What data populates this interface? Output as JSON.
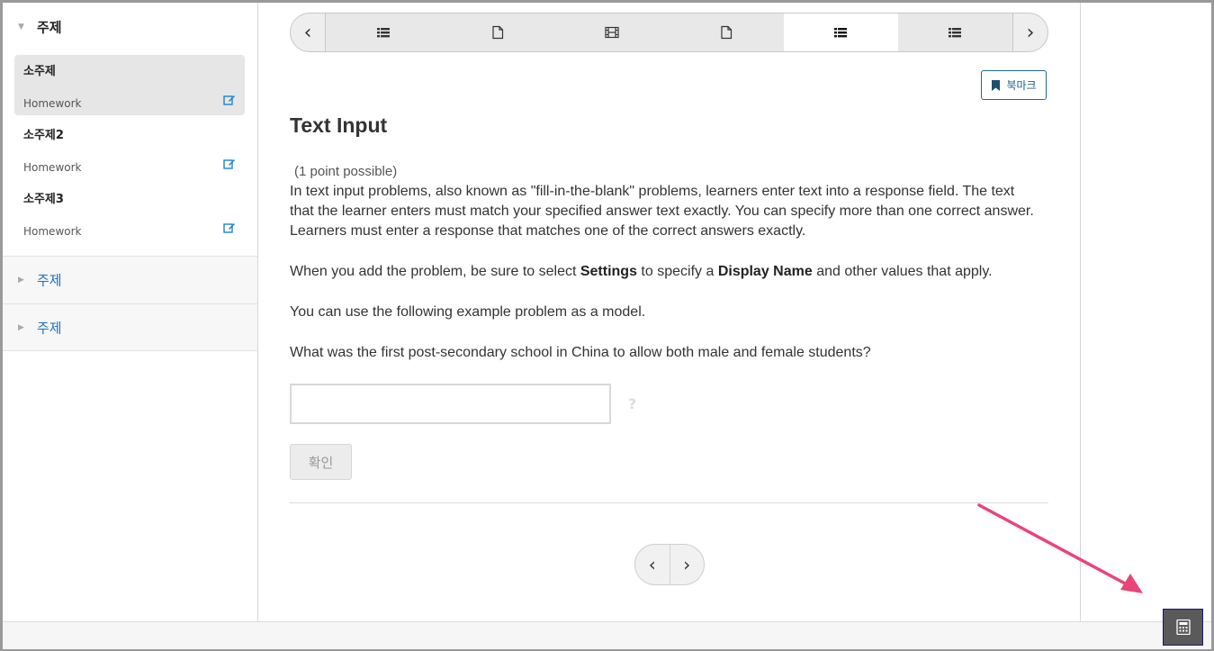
{
  "sidebar": {
    "sections": [
      {
        "title": "주제",
        "expanded": true
      },
      {
        "title": "주제",
        "expanded": false
      },
      {
        "title": "주제",
        "expanded": false
      }
    ],
    "subsections": [
      {
        "title": "소주제",
        "meta": "Homework",
        "active": true
      },
      {
        "title": "소주제2",
        "meta": "Homework",
        "active": false
      },
      {
        "title": "소주제3",
        "meta": "Homework",
        "active": false
      }
    ]
  },
  "sequence_nav": {
    "tabs": [
      {
        "icon": "list-icon"
      },
      {
        "icon": "document-icon"
      },
      {
        "icon": "film-icon"
      },
      {
        "icon": "document-icon"
      },
      {
        "icon": "list-icon",
        "active": true
      },
      {
        "icon": "list-icon"
      }
    ]
  },
  "bookmark": {
    "label": "북마크"
  },
  "problem": {
    "title": "Text Input",
    "points": "(1 point possible)",
    "intro": "In text input problems, also known as \"fill-in-the-blank\" problems, learners enter text into a response field. The text that the learner enters must match your specified answer text exactly. You can specify more than one correct answer. Learners must enter a response that matches one of the correct answers exactly.",
    "settings_before": "When you add the problem, be sure to select ",
    "settings_strong1": "Settings",
    "settings_middle": " to specify a ",
    "settings_strong2": "Display Name",
    "settings_after": " and other values that apply.",
    "model_text": "You can use the following example problem as a model.",
    "question": "What was the first post-secondary school in China to allow both male and female students?",
    "answer_value": "",
    "help_mark": "?",
    "submit_label": "확인"
  },
  "colors": {
    "link_blue": "#1a73b8",
    "bookmark_border": "#1d6a8f",
    "annotation_arrow": "#e8457a",
    "calculator_bg": "#5a5a5a"
  },
  "calculator": {
    "icon": "calculator-icon"
  }
}
